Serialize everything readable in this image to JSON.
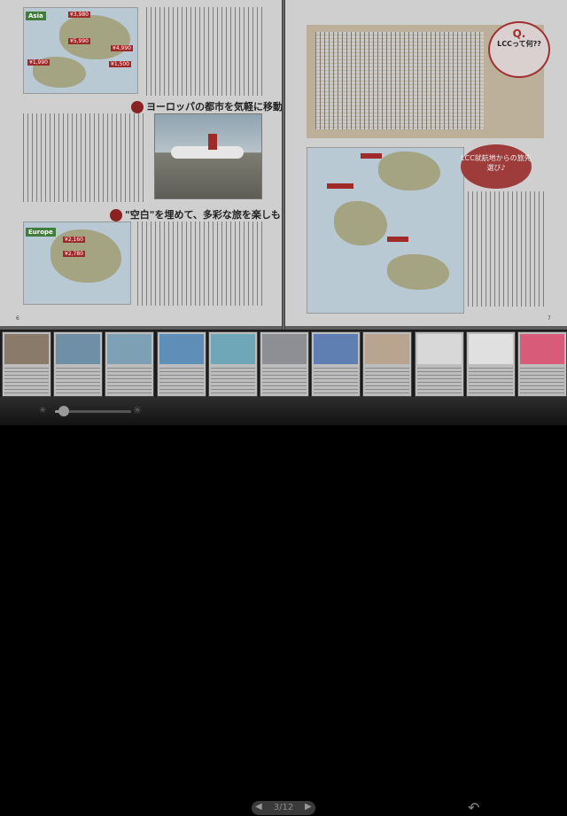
{
  "magazine": {
    "left_page": {
      "map_tag_asia": "Asia",
      "asia_prices": [
        "¥3,980",
        "¥5,990",
        "¥4,990",
        "¥1,990",
        "¥1,500"
      ],
      "heading_europe": "ヨーロッパの都市を気軽に移動♪",
      "heading_blank": "\"空白\"を埋めて、多彩な旅を楽しもう!",
      "map_tag_europe": "Europe",
      "europe_prices": [
        "¥2,160",
        "¥2,780"
      ],
      "page_number": "6"
    },
    "right_page": {
      "q_mark": "Q.",
      "q_text": "LCCって何??",
      "circle_text": "LCC就航地からの旅先選び♪",
      "page_number": "7"
    }
  },
  "thumbnails": {
    "count": 11,
    "colors": [
      "#8a7a6a",
      "#6f8fa6",
      "#7da0b5",
      "#5f8fb8",
      "#6fa6b8",
      "#8d8f94",
      "#5f7fb3",
      "#b8a48f",
      "#d8d8d8",
      "#e0e0e0",
      "#d85c7a"
    ]
  },
  "toolbar": {
    "page_indicator": "3/12",
    "brightness_level": 0.12,
    "icons": {
      "brightness_low": "sun-small-icon",
      "brightness_high": "sun-large-icon",
      "prev": "triangle-left-icon",
      "next": "triangle-right-icon",
      "back": "return-arrow-icon"
    }
  },
  "colors": {
    "accent_red": "#9e2a2a",
    "toolbar_bg": "#1e1e1e",
    "map_sea": "#b8c9d3"
  }
}
